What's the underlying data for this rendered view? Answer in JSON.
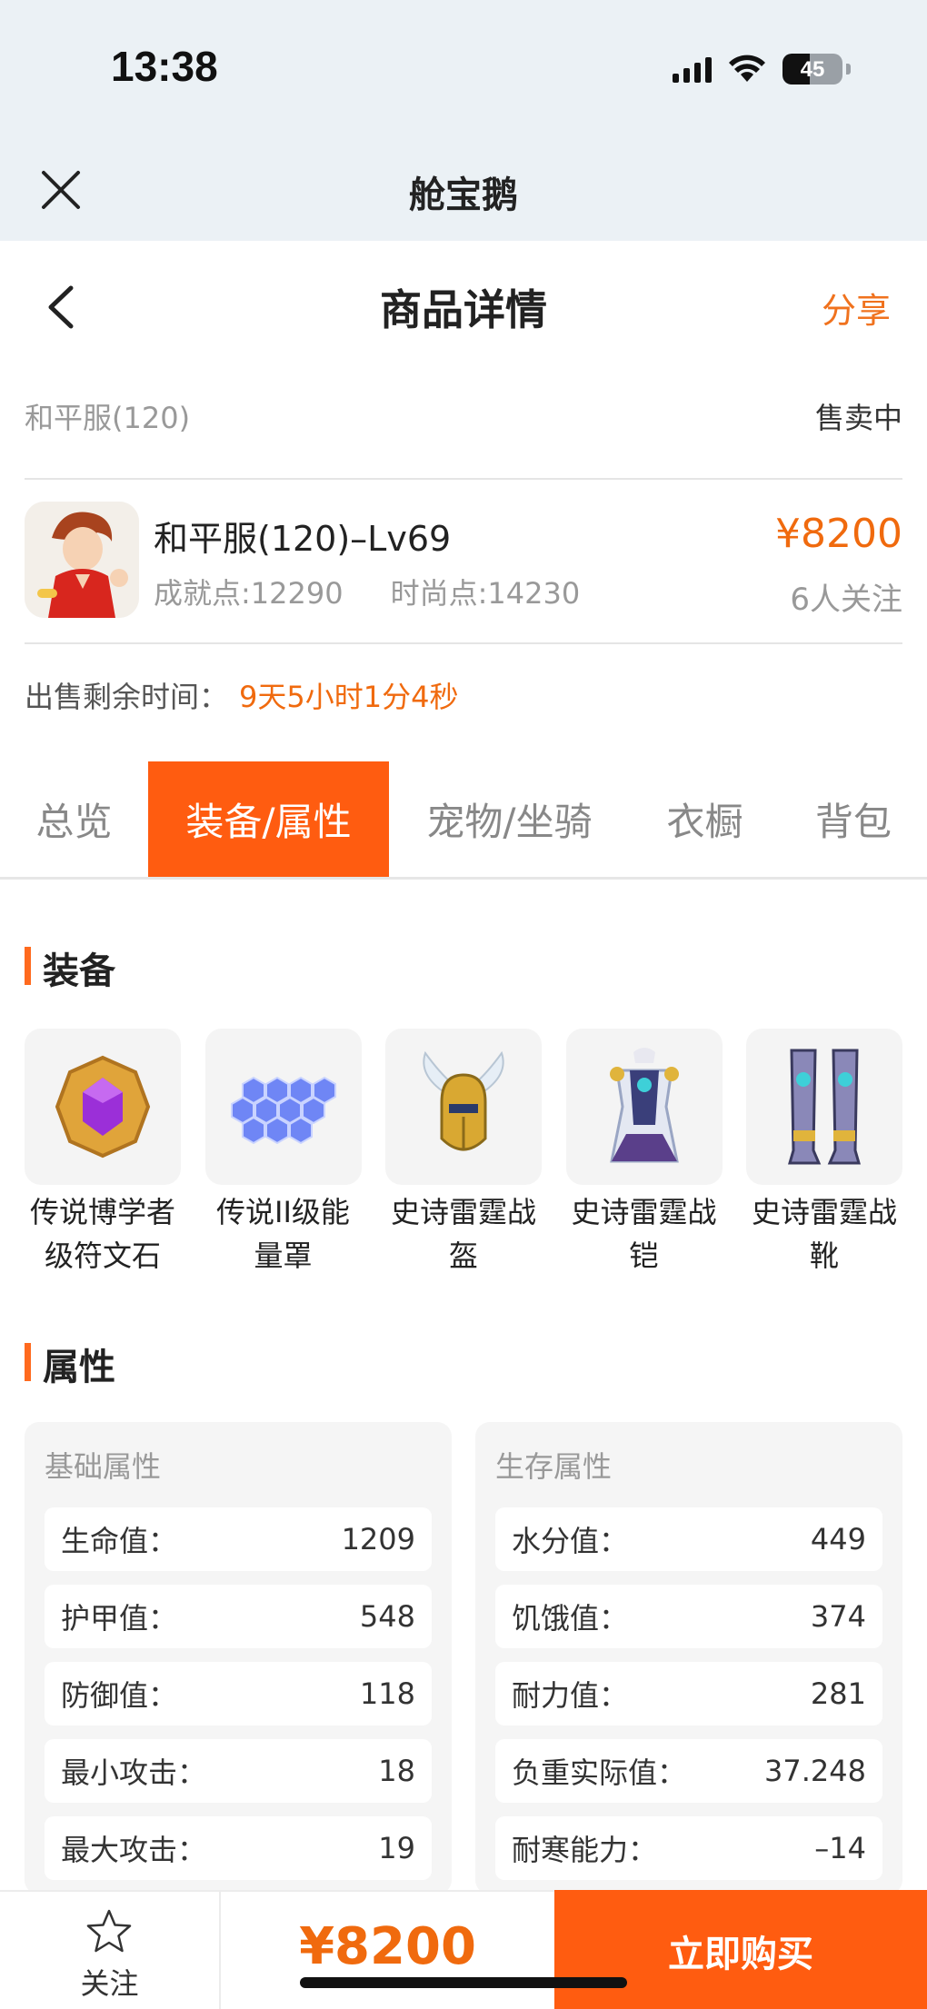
{
  "status_bar": {
    "time": "13:38",
    "battery": "45",
    "battery_level": 0.45
  },
  "app_bar": {
    "title": "舱宝鹅"
  },
  "nav": {
    "title": "商品详情",
    "share_label": "分享"
  },
  "server": {
    "name": "和平服(120)",
    "status": "售卖中"
  },
  "product": {
    "name": "和平服(120)–Lv69",
    "achievement": "成就点:12290",
    "fashion": "时尚点:14230",
    "price": "¥8200",
    "followers": "6人关注"
  },
  "remaining": {
    "label": "出售剩余时间：",
    "value": "9天5小时1分4秒"
  },
  "tabs": [
    {
      "label": "总览",
      "active": false
    },
    {
      "label": "装备/属性",
      "active": true
    },
    {
      "label": "宠物/坐骑",
      "active": false
    },
    {
      "label": "衣橱",
      "active": false
    },
    {
      "label": "背包",
      "active": false
    }
  ],
  "equipment": {
    "title": "装备",
    "items": [
      {
        "line1": "传说博学者",
        "line2": "级符文石",
        "icon": "rune-stone-icon"
      },
      {
        "line1": "传说II级能",
        "line2": "量罩",
        "icon": "energy-shield-icon"
      },
      {
        "line1": "史诗雷霆战",
        "line2": "盔",
        "icon": "helmet-icon"
      },
      {
        "line1": "史诗雷霆战",
        "line2": "铠",
        "icon": "armor-icon"
      },
      {
        "line1": "史诗雷霆战",
        "line2": "靴",
        "icon": "boots-icon"
      }
    ]
  },
  "attributes": {
    "title": "属性",
    "basic": {
      "caption": "基础属性",
      "rows": [
        {
          "label": "生命值：",
          "value": "1209"
        },
        {
          "label": "护甲值：",
          "value": "548"
        },
        {
          "label": "防御值：",
          "value": "118"
        },
        {
          "label": "最小攻击：",
          "value": "18"
        },
        {
          "label": "最大攻击：",
          "value": "19"
        }
      ]
    },
    "survival": {
      "caption": "生存属性",
      "rows": [
        {
          "label": "水分值：",
          "value": "449"
        },
        {
          "label": "饥饿值：",
          "value": "374"
        },
        {
          "label": "耐力值：",
          "value": "281"
        },
        {
          "label": "负重实际值：",
          "value": "37.248"
        },
        {
          "label": "耐寒能力：",
          "value": "–14"
        }
      ]
    }
  },
  "bottom_bar": {
    "follow_label": "关注",
    "price": "¥8200",
    "buy_label": "立即购买"
  },
  "colors": {
    "accent": "#ff5c10",
    "price": "#f06a0e",
    "status_bg": "#ebf1f5"
  }
}
